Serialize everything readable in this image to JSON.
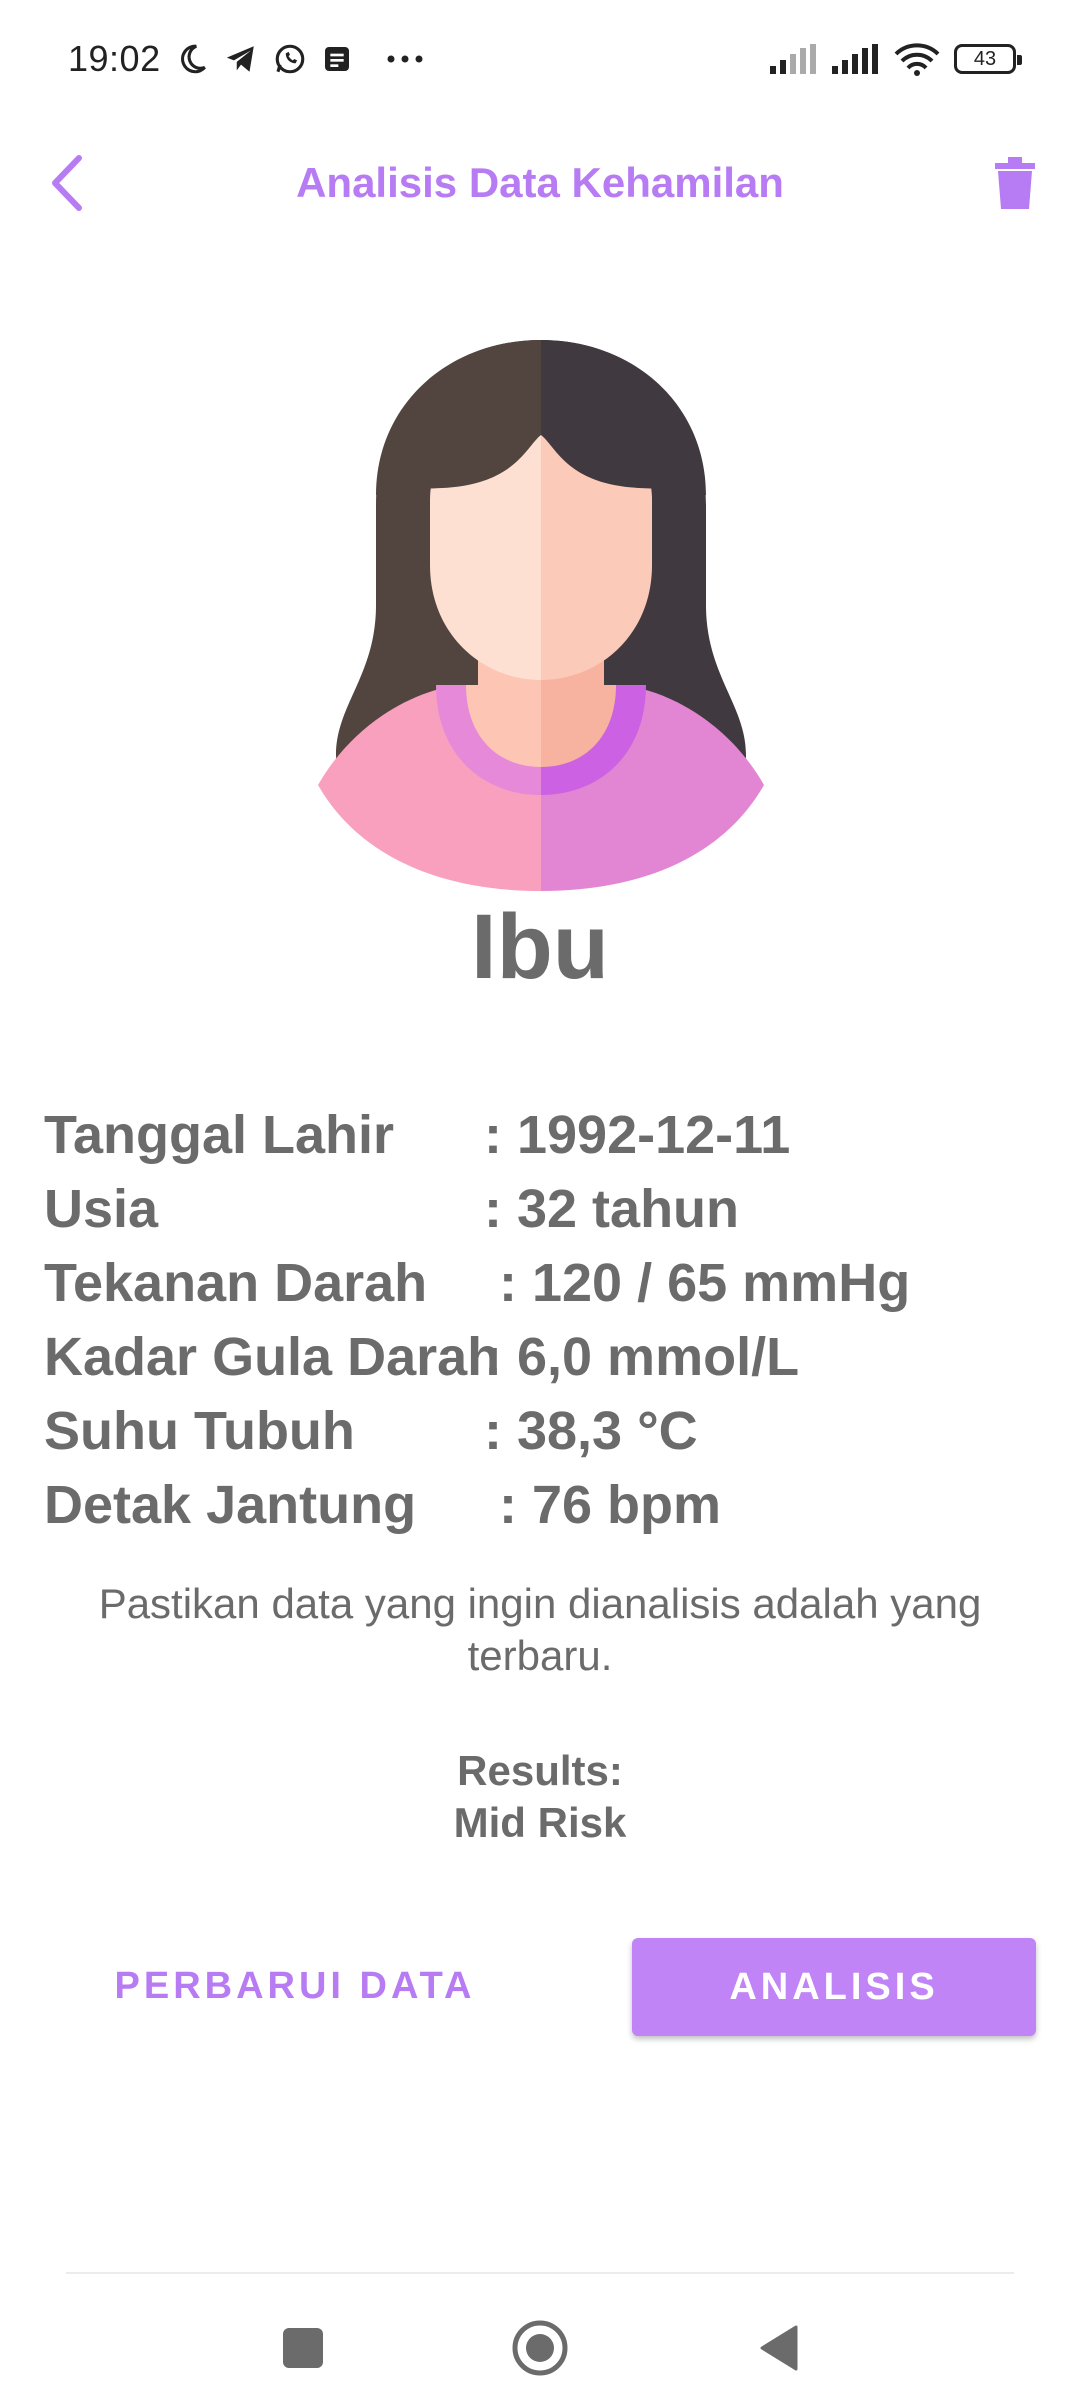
{
  "status_bar": {
    "time": "19:02",
    "battery": "43",
    "left_icons": [
      "moon-icon",
      "telegram-icon",
      "whatsapp-icon",
      "notes-icon",
      "more-dots-icon"
    ],
    "right_icons": [
      "signal-icon",
      "signal-icon",
      "wifi-icon",
      "battery-icon"
    ]
  },
  "header": {
    "title": "Analisis Data Kehamilan",
    "back_icon": "chevron-left-icon",
    "delete_icon": "trash-icon",
    "accent_color": "#b77bf3"
  },
  "profile": {
    "name": "Ibu",
    "avatar": "woman-avatar-illustration"
  },
  "details": [
    {
      "label": "Tanggal Lahir",
      "value": ": 1992-12-11"
    },
    {
      "label": "Usia",
      "value": ": 32 tahun"
    },
    {
      "label": "Tekanan Darah",
      "value": " : 120 / 65 mmHg"
    },
    {
      "label": "Kadar Gula Darah",
      "value": ": 6,0 mmol/L"
    },
    {
      "label": "Suhu Tubuh",
      "value": ": 38,3 °C"
    },
    {
      "label": "Detak Jantung",
      "value": " : 76 bpm"
    }
  ],
  "hint": "Pastikan data yang ingin dianalisis adalah yang terbaru.",
  "results": {
    "label": "Results:",
    "value": "Mid Risk"
  },
  "buttons": {
    "update": "PERBARUI DATA",
    "analyze": "ANALISIS",
    "analyze_color": "#c084f7"
  },
  "nav": {
    "recent_icon": "square-icon",
    "home_icon": "circle-home-icon",
    "back_icon": "triangle-back-icon"
  }
}
